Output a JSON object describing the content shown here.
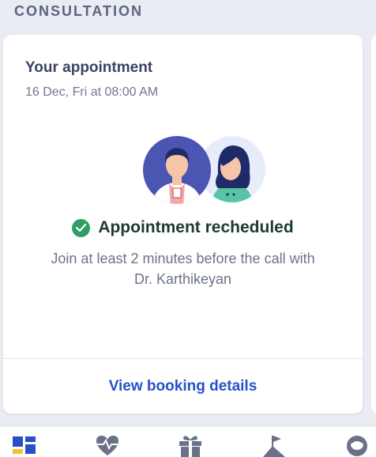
{
  "section": {
    "title": "CONSULTATION"
  },
  "appointment": {
    "title": "Your appointment",
    "datetime": "16 Dec, Fri at 08:00 AM",
    "status": "Appointment recheduled",
    "message_line1": "Join at least 2 minutes before the call with",
    "message_line2": "Dr. Karthikeyan",
    "link_label": "View booking details"
  },
  "nav": {
    "items": [
      {
        "icon": "dashboard-icon",
        "active": true
      },
      {
        "icon": "heartbeat-icon",
        "active": false
      },
      {
        "icon": "gift-icon",
        "active": false
      },
      {
        "icon": "flag-mountain-icon",
        "active": false
      },
      {
        "icon": "profile-icon",
        "active": false
      }
    ]
  },
  "colors": {
    "accent": "#2850c9",
    "success": "#2e9e64",
    "background": "#e9ecf3"
  }
}
